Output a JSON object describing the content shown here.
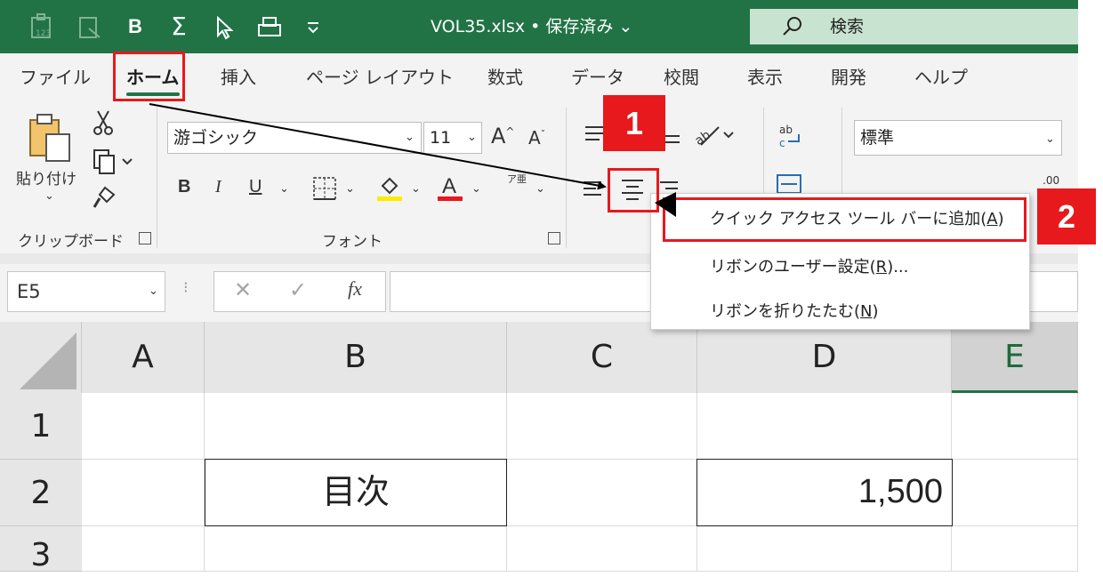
{
  "titlebar": {
    "doc_title": "VOL35.xlsx • 保存済み ⌄",
    "search_label": "検索",
    "qat_bold": "B",
    "qat_sum": "Σ"
  },
  "tabs": [
    "ファイル",
    "ホーム",
    "挿入",
    "ページ レイアウト",
    "数式",
    "データ",
    "校閲",
    "表示",
    "開発",
    "ヘルプ"
  ],
  "ribbon": {
    "paste_label": "貼り付け",
    "clipboard_group": "クリップボード",
    "font_name": "游ゴシック",
    "font_size": "11",
    "font_group": "フォント",
    "bold": "B",
    "italic": "I",
    "underline": "U",
    "number_format": "標準",
    "phonetic": "ア亜"
  },
  "formula_bar": {
    "name_box": "E5",
    "fx": "fx",
    "formula": ""
  },
  "context_menu": {
    "items": [
      {
        "label": "クイック アクセス ツール バーに追加(",
        "key": "A",
        "suffix": ")"
      },
      {
        "label": "リボンのユーザー設定(",
        "key": "R",
        "suffix": ")..."
      },
      {
        "label": "リボンを折りたたむ(",
        "key": "N",
        "suffix": ")"
      }
    ]
  },
  "grid": {
    "columns": [
      "A",
      "B",
      "C",
      "D",
      "E"
    ],
    "rows": [
      "1",
      "2",
      "3"
    ],
    "cells": {
      "B2": "目次",
      "D2": "1,500"
    }
  },
  "annotations": {
    "step1": "1",
    "step2": "2"
  },
  "colors": {
    "accent": "#217346",
    "highlight": "#e8191c",
    "search_bg": "#c8e3d0"
  }
}
